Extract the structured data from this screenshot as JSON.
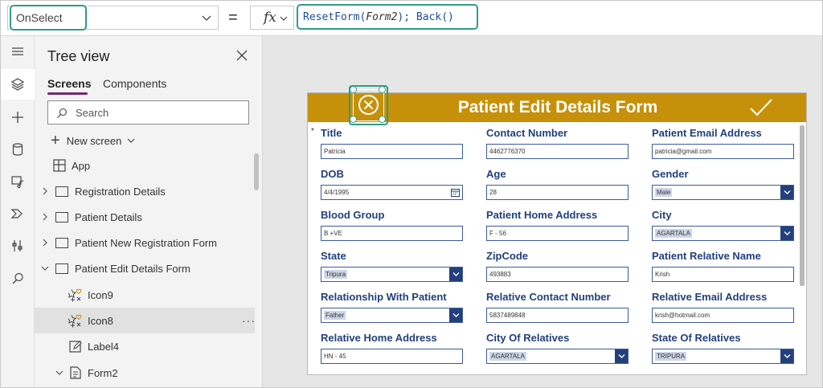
{
  "formula_bar": {
    "property": "OnSelect",
    "equals": "=",
    "fx": "fx",
    "formula_prefix": "ResetForm(",
    "formula_arg": "Form2",
    "formula_suffix": "); Back()"
  },
  "tree_view": {
    "title": "Tree view",
    "tabs": [
      "Screens",
      "Components"
    ],
    "search_placeholder": "Search",
    "new_screen": "New screen",
    "items": [
      {
        "label": "App"
      },
      {
        "label": "Registration Details"
      },
      {
        "label": "Patient Details"
      },
      {
        "label": "Patient New Registration Form"
      },
      {
        "label": "Patient Edit Details Form"
      },
      {
        "label": "Icon9"
      },
      {
        "label": "Icon8"
      },
      {
        "label": "Label4"
      },
      {
        "label": "Form2"
      }
    ],
    "more": "···"
  },
  "form": {
    "title": "Patient Edit Details Form",
    "required_marker": "*",
    "fields": [
      {
        "label": "Title",
        "value": "Patricia",
        "type": "text"
      },
      {
        "label": "Contact Number",
        "value": "4462776370",
        "type": "text"
      },
      {
        "label": "Patient Email Address",
        "value": "patricia@gmail.com",
        "type": "text"
      },
      {
        "label": "DOB",
        "value": "4/4/1995",
        "type": "date"
      },
      {
        "label": "Age",
        "value": "28",
        "type": "text"
      },
      {
        "label": "Gender",
        "value": "Male",
        "type": "dropdown"
      },
      {
        "label": "Blood Group",
        "value": "B +VE",
        "type": "text"
      },
      {
        "label": "Patient Home Address",
        "value": "F - 56",
        "type": "text"
      },
      {
        "label": "City",
        "value": "AGARTALA",
        "type": "dropdown"
      },
      {
        "label": "State",
        "value": "Tripura",
        "type": "dropdown"
      },
      {
        "label": "ZipCode",
        "value": "493883",
        "type": "text"
      },
      {
        "label": "Patient Relative Name",
        "value": "Krish",
        "type": "text"
      },
      {
        "label": "Relationship With Patient",
        "value": "Father",
        "type": "dropdown"
      },
      {
        "label": "Relative Contact Number",
        "value": "5837489848",
        "type": "text"
      },
      {
        "label": "Relative Email Address",
        "value": "krish@hotmail.com",
        "type": "text"
      },
      {
        "label": "Relative Home Address",
        "value": "HN - 45",
        "type": "text"
      },
      {
        "label": "City Of Relatives",
        "value": "AGARTALA",
        "type": "dropdown"
      },
      {
        "label": "State Of Relatives",
        "value": "TRIPURA",
        "type": "dropdown"
      }
    ]
  },
  "colors": {
    "accent": "#2e9e82",
    "header": "#c6900a",
    "label": "#23407d",
    "tab_underline": "#742774"
  }
}
